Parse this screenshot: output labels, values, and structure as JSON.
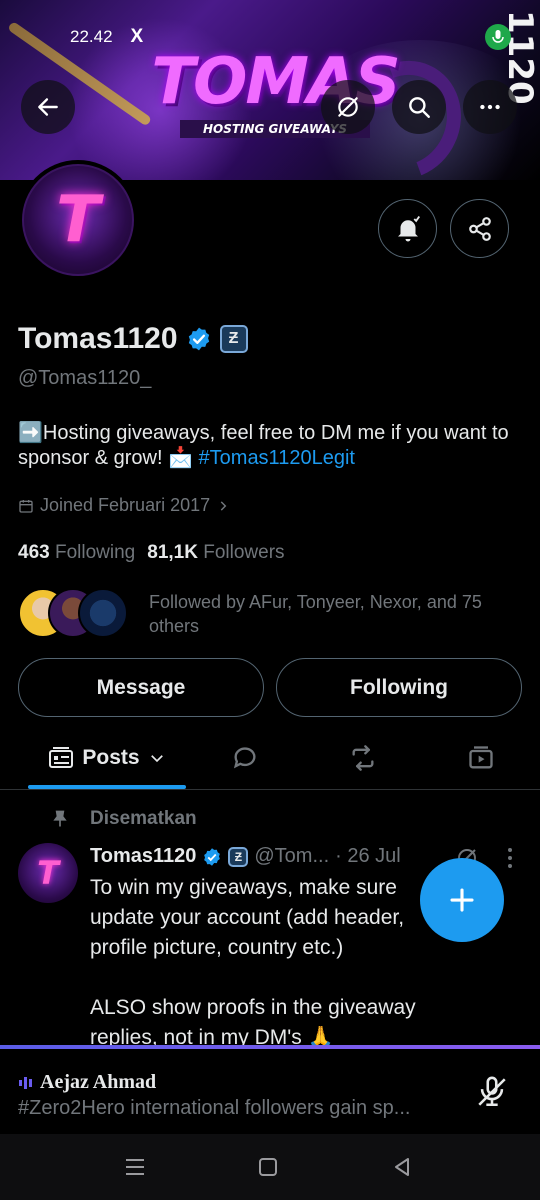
{
  "status_bar": {
    "time": "22.42",
    "x_logo": "X"
  },
  "banner": {
    "title": "TOMAS",
    "subtitle": "HOSTING GIVEAWAYS",
    "side_text": "1120"
  },
  "profile": {
    "name": "Tomas1120",
    "affiliate_badge": "Ƶ",
    "handle": "@Tomas1120_",
    "bio_text": "➡️Hosting giveaways, feel free to DM me if you want to sponsor & grow! 📩 ",
    "bio_hashtag": "#Tomas1120Legit",
    "joined": "Joined Februari 2017",
    "following_count": "463",
    "following_label": "Following",
    "followers_count": "81,1K",
    "followers_label": "Followers",
    "followed_by": "Followed by AFur, Tonyeer, Nexor, and 75 others"
  },
  "buttons": {
    "message": "Message",
    "following": "Following"
  },
  "tabs": {
    "posts": "Posts"
  },
  "pinned_tweet": {
    "pinned_label": "Disematkan",
    "name": "Tomas1120",
    "affiliate_badge": "Ƶ",
    "handle": "@Tom...",
    "date": "· 26 Jul",
    "line1": "To win my giveaways, make sure",
    "line2": "update your account (add header,",
    "line3": "profile picture, country etc.)",
    "line4": "ALSO show proofs in the giveaway",
    "line5": "replies, not in my DM's 🙏"
  },
  "space": {
    "host": "Aejaz Ahmad",
    "title": "#Zero2Hero international followers gain sp..."
  },
  "colors": {
    "accent": "#1d9bf0",
    "space": "#6a5cf0",
    "background": "#000000"
  }
}
